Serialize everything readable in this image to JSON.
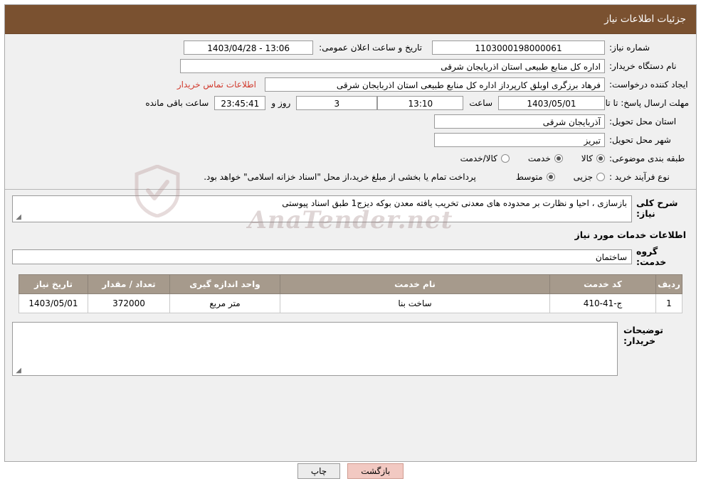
{
  "header": {
    "title": "جزئیات اطلاعات نیاز"
  },
  "form": {
    "need_number_label": "شماره نیاز:",
    "need_number_value": "1103000198000061",
    "announce_label": "تاریخ و ساعت اعلان عمومی:",
    "announce_value": "13:06 - 1403/04/28",
    "buyer_org_label": "نام دستگاه خریدار:",
    "buyer_org_value": "اداره کل منابع طبیعی استان اذربایجان شرقی",
    "creator_label": "ایجاد کننده درخواست:",
    "creator_value": "فرهاد برزگری اوبلق کارپرداز اداره کل منابع طبیعی استان اذربایجان شرقی",
    "contact_link": "اطلاعات تماس خریدار",
    "deadline_label": "مهلت ارسال پاسخ: تا تاریخ:",
    "deadline_date": "1403/05/01",
    "hour_label": "ساعت",
    "deadline_time": "13:10",
    "days_value": "3",
    "days_label": "روز و",
    "remaining_value": "23:45:41",
    "remaining_label": "ساعت باقی مانده",
    "province_label": "استان محل تحویل:",
    "province_value": "آذربایجان شرقی",
    "city_label": "شهر محل تحویل:",
    "city_value": "تبریز",
    "category_label": "طبقه بندی موضوعی:",
    "category_options": [
      {
        "label": "کالا",
        "checked": true
      },
      {
        "label": "خدمت",
        "checked": true
      },
      {
        "label": "کالا/خدمت",
        "checked": false
      }
    ],
    "purchase_type_label": "نوع فرآیند خرید :",
    "purchase_type_options": [
      {
        "label": "جزیی",
        "checked": false
      },
      {
        "label": "متوسط",
        "checked": true
      }
    ],
    "purchase_note": "پرداخت تمام یا بخشی از مبلغ خرید،از محل \"اسناد خزانه اسلامی\" خواهد بود."
  },
  "summary": {
    "label": "شرح کلی نیاز:",
    "value": "بازسازی ، احیا و نظارت بر محدوده های معدنی تخریب یافته معدن بوکه دیزج1 طبق اسناد پیوستی"
  },
  "services": {
    "section_title": "اطلاعات خدمات مورد نیاز",
    "group_label": "گروه خدمت:",
    "group_value": "ساختمان",
    "table": {
      "headers": [
        "ردیف",
        "کد خدمت",
        "نام خدمت",
        "واحد اندازه گیری",
        "تعداد / مقدار",
        "تاریخ نیاز"
      ],
      "rows": [
        [
          "1",
          "ج-41-410",
          "ساخت بنا",
          "متر مربع",
          "372000",
          "1403/05/01"
        ]
      ]
    }
  },
  "buyer_notes": {
    "label": "توضیحات خریدار:",
    "value": ""
  },
  "footer": {
    "print_label": "چاپ",
    "back_label": "بازگشت"
  },
  "watermark": {
    "text": "AnaTender.net"
  },
  "colors": {
    "header_bg": "#7a5130",
    "table_header_bg": "#a69a8c",
    "link": "#d13b2e",
    "back_button": "#f2c9c2"
  }
}
